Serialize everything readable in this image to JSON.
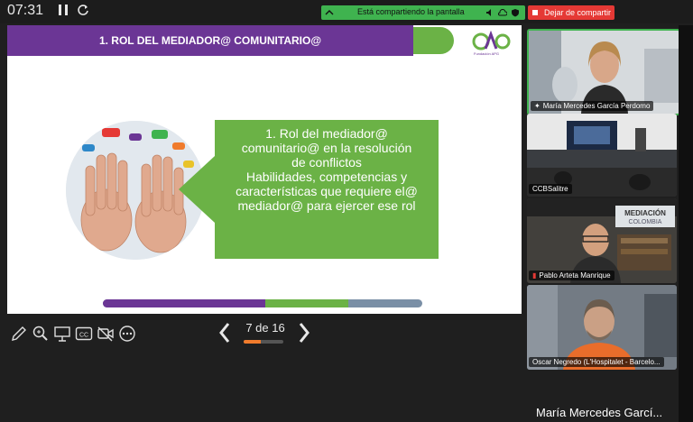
{
  "topbar": {
    "timer": "07:31",
    "pause_icon": "pause-icon",
    "refresh_icon": "refresh-icon",
    "sharing_text": "Está compartiendo la pantalla",
    "stop_sharing_label": "Dejar de compartir"
  },
  "slide": {
    "title": "1. ROL DEL MEDIADOR@ COMUNITARIO@",
    "logo_text": "Fundación APG",
    "callout_lines": [
      "1. Rol del mediador@",
      "comunitario@ en la resolución",
      "de conflictos",
      "Habilidades, competencias y",
      "características que requiere el@",
      "mediador@ para ejercer ese rol"
    ],
    "progress_colors": [
      "#6b3695",
      "#6bb246",
      "#7a8fa6"
    ]
  },
  "toolbar": {
    "tools": [
      "pen-icon",
      "zoom-icon",
      "pointer-icon",
      "captions-icon",
      "video-off-icon",
      "more-icon"
    ],
    "page_label": "7 de 16",
    "page_progress": 0.4375
  },
  "participants": [
    {
      "name": "María Mercedes García Perdomo",
      "pinned": true,
      "muted": false
    },
    {
      "name": "CCBSalitre",
      "pinned": false,
      "muted": false
    },
    {
      "name": "Pablo Arteta Manrique",
      "pinned": false,
      "muted": true
    },
    {
      "name": "Oscar Negredo (L'Hospitalet - Barcelo...",
      "pinned": false,
      "muted": false
    }
  ],
  "active_speaker_name": "María Mercedes Garcí...",
  "colors": {
    "accent_green": "#3fb34f",
    "stop_red": "#e53935",
    "slide_purple": "#6b3695",
    "slide_green": "#6bb246"
  }
}
